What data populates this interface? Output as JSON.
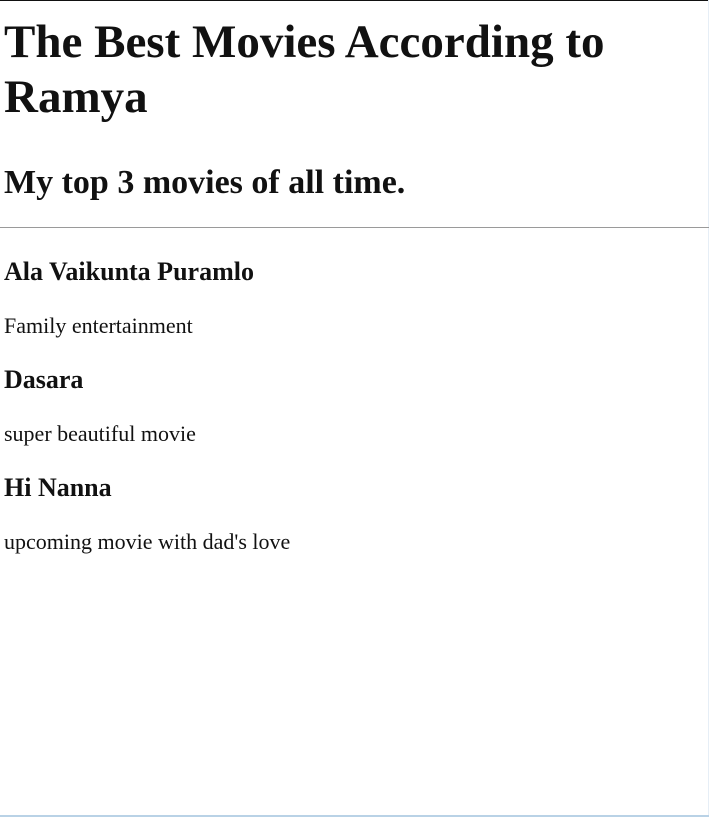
{
  "page": {
    "title": "The Best Movies According to Ramya",
    "subtitle": "My top 3 movies of all time."
  },
  "movies": [
    {
      "title": "Ala Vaikunta Puramlo",
      "description": "Family entertainment"
    },
    {
      "title": "Dasara",
      "description": "super beautiful movie"
    },
    {
      "title": "Hi Nanna",
      "description": "upcoming movie with dad's love"
    }
  ]
}
